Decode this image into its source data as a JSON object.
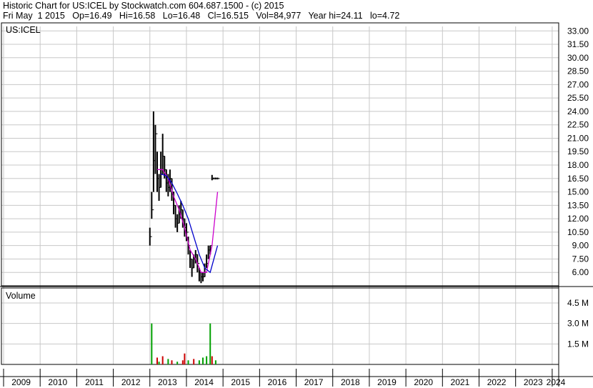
{
  "header": {
    "line1": "Historic Chart for US:ICEL by Stockwatch.com 604.687.1500 - (c) 2015",
    "line2": "Fri May  1 2015   Op=16.49   Hi=16.58   Lo=16.48   Cl=16.515   Vol=84,977   Year hi=24.11   lo=4.72"
  },
  "chart_data": [
    {
      "type": "line",
      "symbol_label": "US:ICEL",
      "x_labels": [
        "2009",
        "2010",
        "2011",
        "2012",
        "2013",
        "2014",
        "2015",
        "2016",
        "2017",
        "2018",
        "2019",
        "2020",
        "2021",
        "2022",
        "2023",
        "2024"
      ],
      "y_ticks": [
        "33.00",
        "31.50",
        "30.00",
        "28.50",
        "27.00",
        "25.50",
        "24.00",
        "22.50",
        "21.00",
        "19.50",
        "18.00",
        "16.50",
        "15.00",
        "13.50",
        "12.00",
        "10.50",
        "9.00",
        "7.50",
        "6.00"
      ],
      "ylim": [
        4.5,
        33.5
      ],
      "grid": true,
      "series": [
        {
          "values_note": "",
          "x": [
            2013.0,
            2013.05,
            2013.1,
            2013.15,
            2013.2,
            2013.25,
            2013.3,
            2013.35,
            2013.4,
            2013.45,
            2013.5,
            2013.55,
            2013.6,
            2013.65,
            2013.7,
            2013.75,
            2013.8,
            2013.85,
            2013.9,
            2013.95,
            2014.0,
            2014.05,
            2014.1,
            2014.15,
            2014.2,
            2014.25,
            2014.3,
            2014.35,
            2014.4,
            2014.45,
            2014.5,
            2014.55,
            2014.6,
            2014.65,
            2014.7,
            2014.75,
            2014.8,
            2014.85
          ],
          "close": [
            10.0,
            13.0,
            18.5,
            21.5,
            16.5,
            15.5,
            17.0,
            19.0,
            17.5,
            16.0,
            15.5,
            16.5,
            15.0,
            13.5,
            12.0,
            11.5,
            12.5,
            13.0,
            12.0,
            11.0,
            10.5,
            9.0,
            7.5,
            6.5,
            7.5,
            8.0,
            7.0,
            6.0,
            5.5,
            5.5,
            6.0,
            7.0,
            8.5,
            9.0,
            16.5,
            16.5,
            16.5,
            16.5
          ],
          "high": [
            11.0,
            15.0,
            24.0,
            22.5,
            19.5,
            17.0,
            19.5,
            21.5,
            19.0,
            17.5,
            17.0,
            17.5,
            16.5,
            15.0,
            13.5,
            12.5,
            13.5,
            14.0,
            13.0,
            12.0,
            11.5,
            10.0,
            8.5,
            7.5,
            8.0,
            8.5,
            8.0,
            6.5,
            6.0,
            6.0,
            7.0,
            8.0,
            9.0,
            9.0,
            16.9,
            16.6,
            16.6,
            16.6
          ],
          "low": [
            9.0,
            12.0,
            15.0,
            17.0,
            15.0,
            14.0,
            15.5,
            17.0,
            16.5,
            15.0,
            14.5,
            15.0,
            14.0,
            12.5,
            11.0,
            10.5,
            11.5,
            12.0,
            11.0,
            10.0,
            9.5,
            8.0,
            6.5,
            5.5,
            6.5,
            7.0,
            6.0,
            5.0,
            4.8,
            5.0,
            5.5,
            6.5,
            7.5,
            8.0,
            16.3,
            16.4,
            16.4,
            16.4
          ]
        },
        {
          "name": "",
          "x": [
            2013.2,
            2013.35,
            2013.5,
            2013.65,
            2013.8,
            2013.95,
            2014.1,
            2014.25,
            2014.4,
            2014.55,
            2014.7,
            2014.85
          ],
          "values": [
            17.5,
            17.5,
            16.5,
            14.5,
            13.0,
            11.0,
            8.5,
            7.5,
            6.0,
            6.0,
            9.0,
            15.0
          ]
        },
        {
          "name": "",
          "x": [
            2013.3,
            2013.45,
            2013.6,
            2013.75,
            2013.9,
            2014.05,
            2014.2,
            2014.35,
            2014.5,
            2014.65,
            2014.85
          ],
          "values": [
            17.0,
            16.8,
            16.0,
            14.8,
            13.5,
            12.0,
            10.0,
            8.0,
            6.5,
            6.0,
            9.0
          ]
        }
      ]
    },
    {
      "type": "bar",
      "title": "Volume",
      "y_ticks": [
        "4.5 M",
        "3.0 M",
        "1.5 M"
      ],
      "ylim": [
        0,
        5.6
      ],
      "unit": "M",
      "x": [
        2013.05,
        2013.2,
        2013.25,
        2013.35,
        2013.5,
        2013.6,
        2013.75,
        2013.9,
        2013.95,
        2014.05,
        2014.2,
        2014.35,
        2014.45,
        2014.55,
        2014.65,
        2014.7,
        2014.8
      ],
      "values": [
        3.0,
        0.5,
        0.2,
        0.6,
        0.4,
        0.3,
        0.2,
        0.3,
        0.8,
        0.3,
        0.4,
        0.3,
        0.5,
        0.6,
        3.0,
        0.6,
        0.3
      ],
      "colors": [
        "#00a000",
        "#cc0000",
        "#00a000",
        "#cc0000",
        "#00a000",
        "#cc0000",
        "#00a000",
        "#cc0000",
        "#cc0000",
        "#00a000",
        "#cc0000",
        "#00a000",
        "#00a000",
        "#00a000",
        "#00a000",
        "#cc0000",
        "#00a000"
      ]
    }
  ],
  "colors": {
    "grid": "#c8c8c8",
    "price": "#000000",
    "ma_short": "#cc00cc",
    "ma_long": "#0000cc",
    "up": "#00a000",
    "down": "#cc0000"
  }
}
